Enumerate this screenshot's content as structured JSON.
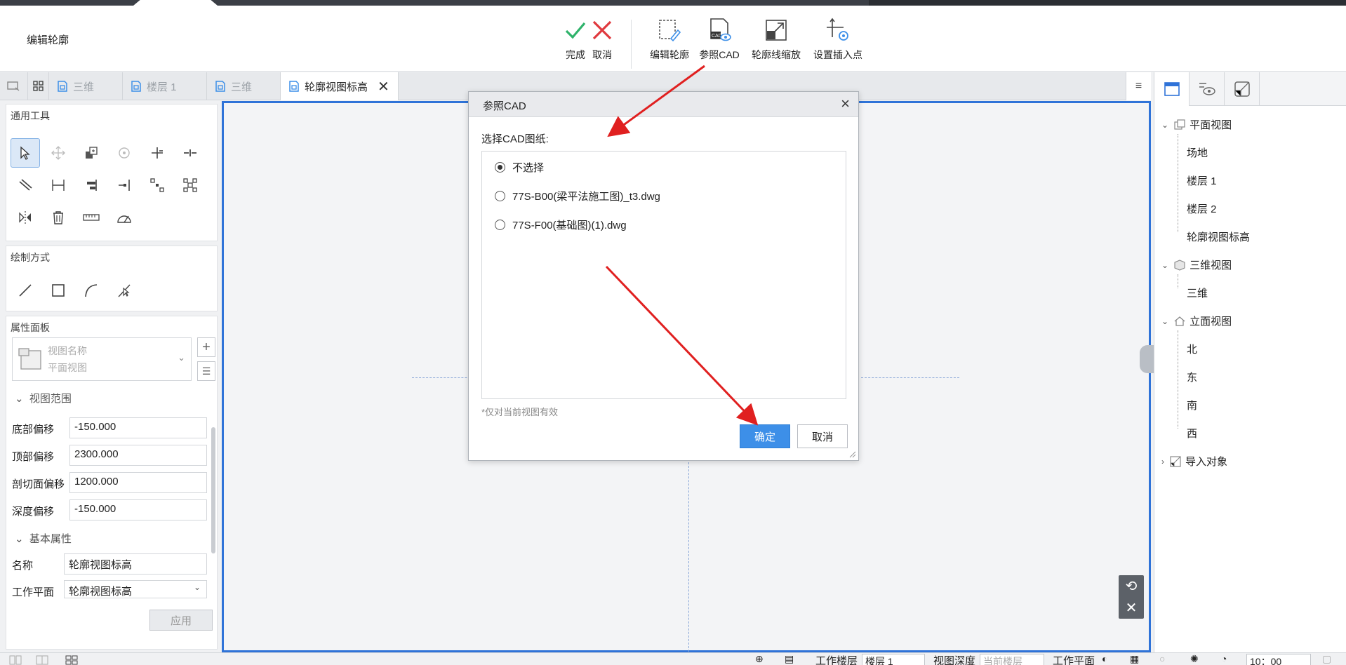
{
  "ribbon": {
    "title": "编辑轮廓",
    "buttons": [
      {
        "label": "完成",
        "icon": "check-icon"
      },
      {
        "label": "取消",
        "icon": "cross-icon"
      },
      {
        "label": "编辑轮廓",
        "icon": "edit-outline-icon"
      },
      {
        "label": "参照CAD",
        "icon": "reference-cad-icon"
      },
      {
        "label": "轮廓线缩放",
        "icon": "outline-scale-icon"
      },
      {
        "label": "设置插入点",
        "icon": "insert-point-icon"
      }
    ]
  },
  "tabs": [
    {
      "label": "三维",
      "active": false
    },
    {
      "label": "楼层 1",
      "active": false
    },
    {
      "label": "三维",
      "active": false
    },
    {
      "label": "轮廓视图标高",
      "active": true
    }
  ],
  "left_panel": {
    "general_tools_title": "通用工具",
    "draw_mode_title": "绘制方式",
    "properties_title": "属性面板",
    "view_name_label": "视图名称",
    "view_name_value": "平面视图",
    "view_range_group": "视图范围",
    "view_range": [
      {
        "label": "底部偏移",
        "value": "-150.000"
      },
      {
        "label": "顶部偏移",
        "value": "2300.000"
      },
      {
        "label": "剖切面偏移",
        "value": "1200.000"
      },
      {
        "label": "深度偏移",
        "value": "-150.000"
      }
    ],
    "basic_group": "基本属性",
    "name_label": "名称",
    "name_value": "轮廓视图标高",
    "workplane_label": "工作平面",
    "workplane_value": "轮廓视图标高",
    "apply_label": "应用"
  },
  "dialog": {
    "title": "参照CAD",
    "prompt": "选择CAD图纸:",
    "options": [
      {
        "label": "不选择",
        "selected": true
      },
      {
        "label": "77S-B00(梁平法施工图)_t3.dwg",
        "selected": false
      },
      {
        "label": "77S-F00(基础图)(1).dwg",
        "selected": false
      }
    ],
    "hint": "*仅对当前视图有效",
    "ok_label": "确定",
    "cancel_label": "取消"
  },
  "tree": {
    "plan_views": "平面视图",
    "plan_children": [
      "场地",
      "楼层 1",
      "楼层 2",
      "轮廓视图标高"
    ],
    "views_3d": "三维视图",
    "children_3d": [
      "三维"
    ],
    "elevation_views": "立面视图",
    "elevation_children": [
      "北",
      "东",
      "南",
      "西"
    ],
    "import_objects": "导入对象"
  },
  "statusbar": {
    "work_floor_label": "工作楼层",
    "work_floor_value": "楼层 1",
    "view_depth_label": "视图深度",
    "view_depth_value": "当前楼层",
    "work_plane_label": "工作平面",
    "scale_value": "10：00"
  },
  "colors": {
    "accent": "#2f73d8",
    "ok_button": "#3d8fe8",
    "check_green": "#2fb36b",
    "cross_red": "#e0393e",
    "annotation_red": "#e02020"
  }
}
